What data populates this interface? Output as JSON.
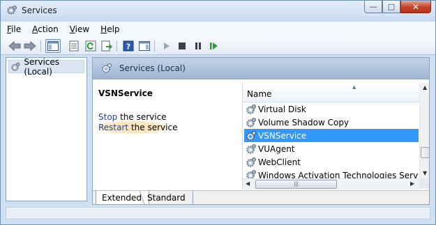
{
  "window": {
    "title": "Services",
    "controls": {
      "minimize": "—",
      "maximize": "□",
      "close": "✕"
    }
  },
  "menu": [
    {
      "accel": "F",
      "rest": "ile"
    },
    {
      "accel": "A",
      "rest": "ction"
    },
    {
      "accel": "V",
      "rest": "iew"
    },
    {
      "accel": "H",
      "rest": "elp"
    }
  ],
  "toolbar": {
    "buttons": [
      "back-icon",
      "forward-icon",
      "show-hide-tree-icon",
      "properties-icon",
      "refresh-icon",
      "export-list-icon",
      "help-icon",
      "action-pane-icon",
      "start-icon",
      "stop-icon",
      "pause-icon",
      "restart-icon"
    ]
  },
  "tree": {
    "item": "Services (Local)"
  },
  "main": {
    "header": "Services (Local)",
    "selected_service": "VSNService",
    "stop_link": "Stop",
    "stop_rest": " the service",
    "restart_link": "Restart",
    "restart_rest": " the service"
  },
  "list": {
    "column": "Name",
    "rows": [
      {
        "name": "Virtual Disk"
      },
      {
        "name": "Volume Shadow Copy"
      },
      {
        "name": "VSNService",
        "selected": true
      },
      {
        "name": "VUAgent"
      },
      {
        "name": "WebClient"
      },
      {
        "name": "Windows Activation Technologies Service"
      }
    ],
    "scroll_up": "▲",
    "scroll_down": "▼",
    "scroll_left": "◀",
    "scroll_right": "▶",
    "thumb_grip": "|||"
  },
  "tabs": [
    "Extended",
    "Standard"
  ],
  "colors": {
    "selection": "#3399ff",
    "link": "#1c3fae",
    "highlight": "#fbe3b2"
  }
}
